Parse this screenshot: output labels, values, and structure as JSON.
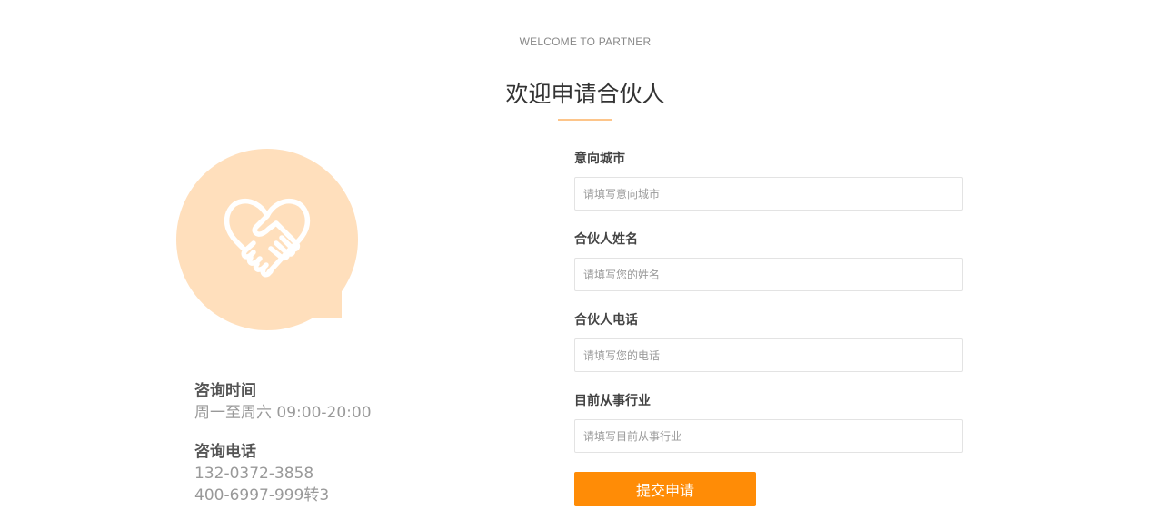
{
  "header": {
    "eyebrow": "WELCOME TO PARTNER",
    "title": "欢迎申请合伙人"
  },
  "colors": {
    "accent": "#ff8c06",
    "illustration_bg": "#ffdfbc",
    "title_rule": "#fdc58a"
  },
  "illustration": {
    "icon": "heart-handshake-icon"
  },
  "contact": {
    "hours_title": "咨询时间",
    "hours_value": "周一至周六 09:00-20:00",
    "phone_title": "咨询电话",
    "phone_1": "132-0372-3858",
    "phone_2": "400-6997-999转3"
  },
  "form": {
    "fields": [
      {
        "label": "意向城市",
        "placeholder": "请填写意向城市",
        "value": ""
      },
      {
        "label": "合伙人姓名",
        "placeholder": "请填写您的姓名",
        "value": ""
      },
      {
        "label": "合伙人电话",
        "placeholder": "请填写您的电话",
        "value": ""
      },
      {
        "label": "目前从事行业",
        "placeholder": "请填写目前从事行业",
        "value": ""
      }
    ],
    "submit_label": "提交申请"
  }
}
